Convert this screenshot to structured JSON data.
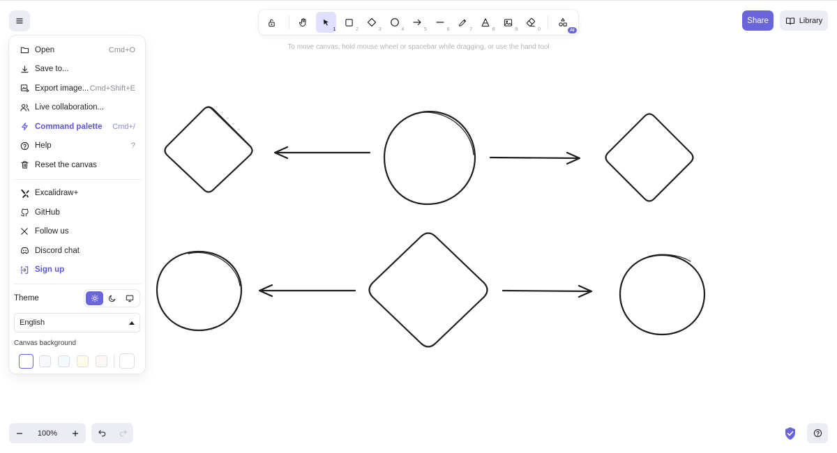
{
  "menu": {
    "items": [
      {
        "label": "Open",
        "shortcut": "Cmd+O",
        "icon": "folder-icon"
      },
      {
        "label": "Save to...",
        "shortcut": "",
        "icon": "download-icon"
      },
      {
        "label": "Export image...",
        "shortcut": "Cmd+Shift+E",
        "icon": "export-image-icon"
      },
      {
        "label": "Live collaboration...",
        "shortcut": "",
        "icon": "users-icon"
      },
      {
        "label": "Command palette",
        "shortcut": "Cmd+/",
        "icon": "bolt-icon"
      },
      {
        "label": "Help",
        "shortcut": "?",
        "icon": "help-circle-icon"
      },
      {
        "label": "Reset the canvas",
        "shortcut": "",
        "icon": "trash-icon"
      }
    ],
    "links": [
      {
        "label": "Excalidraw+",
        "icon": "excalidraw-plus-icon"
      },
      {
        "label": "GitHub",
        "icon": "github-icon"
      },
      {
        "label": "Follow us",
        "icon": "x-logo-icon"
      },
      {
        "label": "Discord chat",
        "icon": "discord-icon"
      },
      {
        "label": "Sign up",
        "icon": "sign-in-icon"
      }
    ],
    "theme_label": "Theme",
    "language": "English",
    "canvas_background_label": "Canvas background",
    "background_swatches": [
      "#ffffff",
      "#f8f9fa",
      "#f5faff",
      "#fffce8",
      "#fdf8f6",
      "#ffffff"
    ]
  },
  "toolbar": {
    "tools": [
      {
        "name": "hand-tool",
        "num": ""
      },
      {
        "name": "selection-tool",
        "num": "1"
      },
      {
        "name": "rectangle-tool",
        "num": "2"
      },
      {
        "name": "diamond-tool",
        "num": "3"
      },
      {
        "name": "ellipse-tool",
        "num": "4"
      },
      {
        "name": "arrow-tool",
        "num": "5"
      },
      {
        "name": "line-tool",
        "num": "6"
      },
      {
        "name": "draw-tool",
        "num": "7"
      },
      {
        "name": "text-tool",
        "num": "8"
      },
      {
        "name": "image-tool",
        "num": "9"
      },
      {
        "name": "eraser-tool",
        "num": "0"
      }
    ],
    "ai_badge": "AI"
  },
  "hint": "To move canvas, hold mouse wheel or spacebar while dragging, or use the hand tool",
  "share_label": "Share",
  "library_label": "Library",
  "zoom": "100%",
  "colors": {
    "accent": "#6965db",
    "accent_light": "#e0dfff",
    "panel": "#ececf4"
  }
}
